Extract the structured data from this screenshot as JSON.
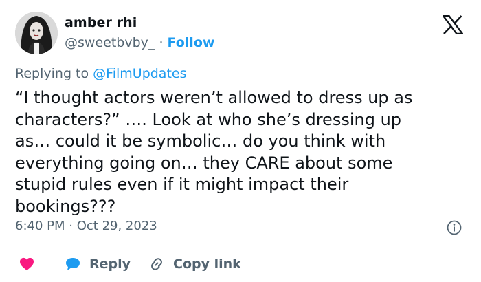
{
  "user": {
    "display_name": "amber rhi",
    "handle": "@sweetbvby_",
    "separator": "·",
    "follow_label": "Follow"
  },
  "reply_context": {
    "prefix": "Replying to",
    "mention": "@FilmUpdates"
  },
  "tweet": {
    "text": "“I thought actors weren’t allowed to dress up as\ncharacters?” …. Look at who she’s dressing up\nas… could it be symbolic… do you think with\neverything going on… they CARE about some\nstupid rules even if it might impact their\nbookings???",
    "time": "6:40 PM",
    "separator": "·",
    "date": "Oct 29, 2023"
  },
  "actions": {
    "reply_label": "Reply",
    "copy_link_label": "Copy link"
  },
  "icons": [
    "x-logo-icon",
    "info-icon",
    "heart-icon",
    "reply-bubble-icon",
    "link-icon"
  ],
  "colors": {
    "accent": "#1d9bf0",
    "secondary_text": "#536471",
    "heart": "#f91880",
    "divider": "#cfd9de"
  }
}
